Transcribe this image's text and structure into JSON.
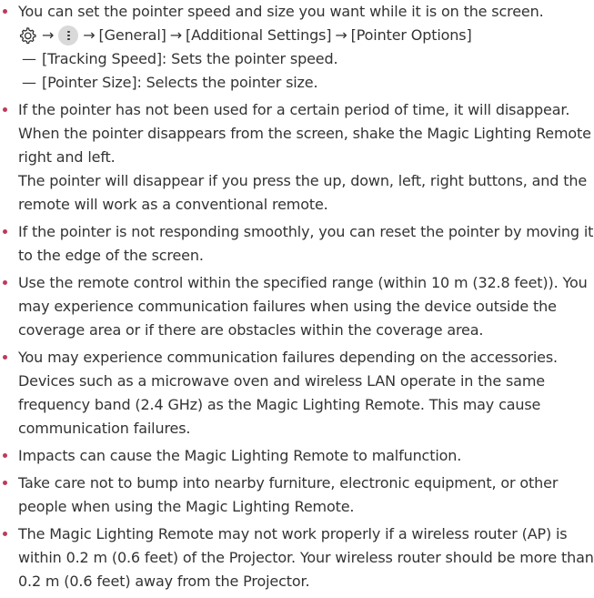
{
  "notes": [
    {
      "line1": "You can set the pointer speed and size you want while it is on the screen.",
      "path": {
        "gear_icon": "gear-icon",
        "more_icon": "more-vertical-icon",
        "arrow": "→",
        "general": "[General]",
        "additional": "[Additional Settings]",
        "pointer_options": "[Pointer Options]"
      },
      "subitems": [
        {
          "dash": "—",
          "text": "[Tracking Speed]: Sets the pointer speed."
        },
        {
          "dash": "—",
          "text": "[Pointer Size]: Selects the pointer size."
        }
      ]
    },
    {
      "p1": "If the pointer has not been used for a certain period of time, it will disappear. When the pointer disappears from the screen, shake the Magic Lighting Remote right and left.",
      "p2": "The pointer will disappear if you press the up, down, left, right buttons, and the remote will work as a conventional remote."
    },
    {
      "text": "If the pointer is not responding smoothly, you can reset the pointer by moving it to the edge of the screen."
    },
    {
      "text": "Use the remote control within the specified range (within 10 m (32.8 feet)). You may experience communication failures when using the device outside the coverage area or if there are obstacles within the coverage area."
    },
    {
      "text": "You may experience communication failures depending on the accessories. Devices such as a microwave oven and wireless LAN operate in the same frequency band (2.4 GHz) as the Magic Lighting Remote. This may cause communication failures."
    },
    {
      "text": "Impacts can cause the Magic Lighting Remote to malfunction."
    },
    {
      "text": "Take care not to bump into nearby furniture, electronic equipment, or other people when using the Magic Lighting Remote."
    },
    {
      "text": "The Magic Lighting Remote may not work properly if a wireless router (AP) is within 0.2 m (0.6 feet) of the Projector. Your wireless router should be more than 0.2 m (0.6 feet) away from the Projector."
    }
  ],
  "colors": {
    "bullet": "#c0395a",
    "text": "#333333",
    "more_icon_bg": "#d9d9d9"
  }
}
